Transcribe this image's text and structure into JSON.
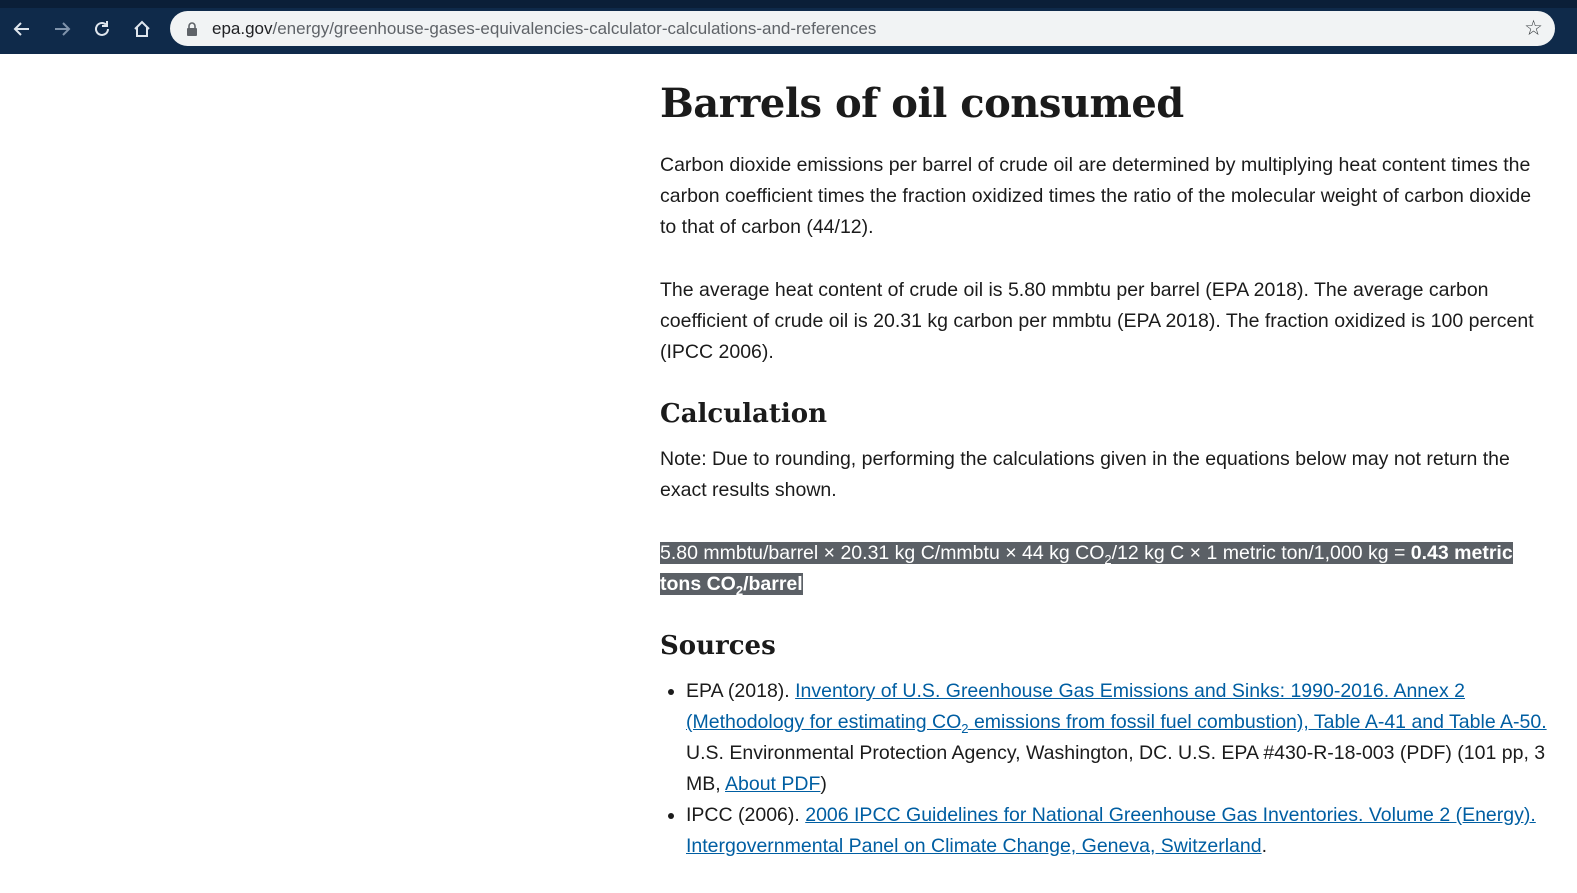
{
  "browser": {
    "url_host": "epa.gov",
    "url_path": "/energy/greenhouse-gases-equivalencies-calculator-calculations-and-references"
  },
  "page": {
    "title": "Barrels of oil consumed",
    "para1": "Carbon dioxide emissions per barrel of crude oil are determined by multiplying heat content times the carbon coefficient times the fraction oxidized times the ratio of the molecular weight of carbon dioxide to that of carbon (44/12).",
    "para2": "The average heat content of crude oil is 5.80 mmbtu per barrel (EPA 2018). The average carbon coefficient of crude oil is 20.31 kg carbon per mmbtu (EPA 2018). The fraction oxidized is 100 percent (IPCC 2006).",
    "calc_heading": "Calculation",
    "note": "Note: Due to rounding, performing the calculations given in the equations below may not return the exact results shown.",
    "calc_part1": "5.80 mmbtu/barrel × 20.31 kg C/mmbtu × 44 kg CO",
    "calc_sub1": "2",
    "calc_part2": "/12 kg C × 1 metric ton/1,000 kg = ",
    "calc_result_a": "0.43 metric tons CO",
    "calc_sub2": "2",
    "calc_result_b": "/barrel",
    "sources_heading": "Sources",
    "source1_prefix": "EPA (2018). ",
    "source1_link_a": "Inventory of U.S. Greenhouse Gas Emissions and Sinks: 1990-2016. Annex 2 (Methodology for estimating CO",
    "source1_link_sub": "2",
    "source1_link_b": " emissions from fossil fuel combustion), Table A-41 and Table A-50.",
    "source1_text": " U.S. Environmental Protection Agency, Washington, DC. U.S. EPA #430-R-18-003 (PDF) (101 pp, 3 MB, ",
    "source1_about": "About PDF",
    "source1_close": ")",
    "source2_prefix": "IPCC (2006). ",
    "source2_link": "2006 IPCC Guidelines for National Greenhouse Gas Inventories. Volume 2 (Energy). Intergovernmental Panel on Climate Change, Geneva, Switzerland",
    "source2_end": "."
  }
}
